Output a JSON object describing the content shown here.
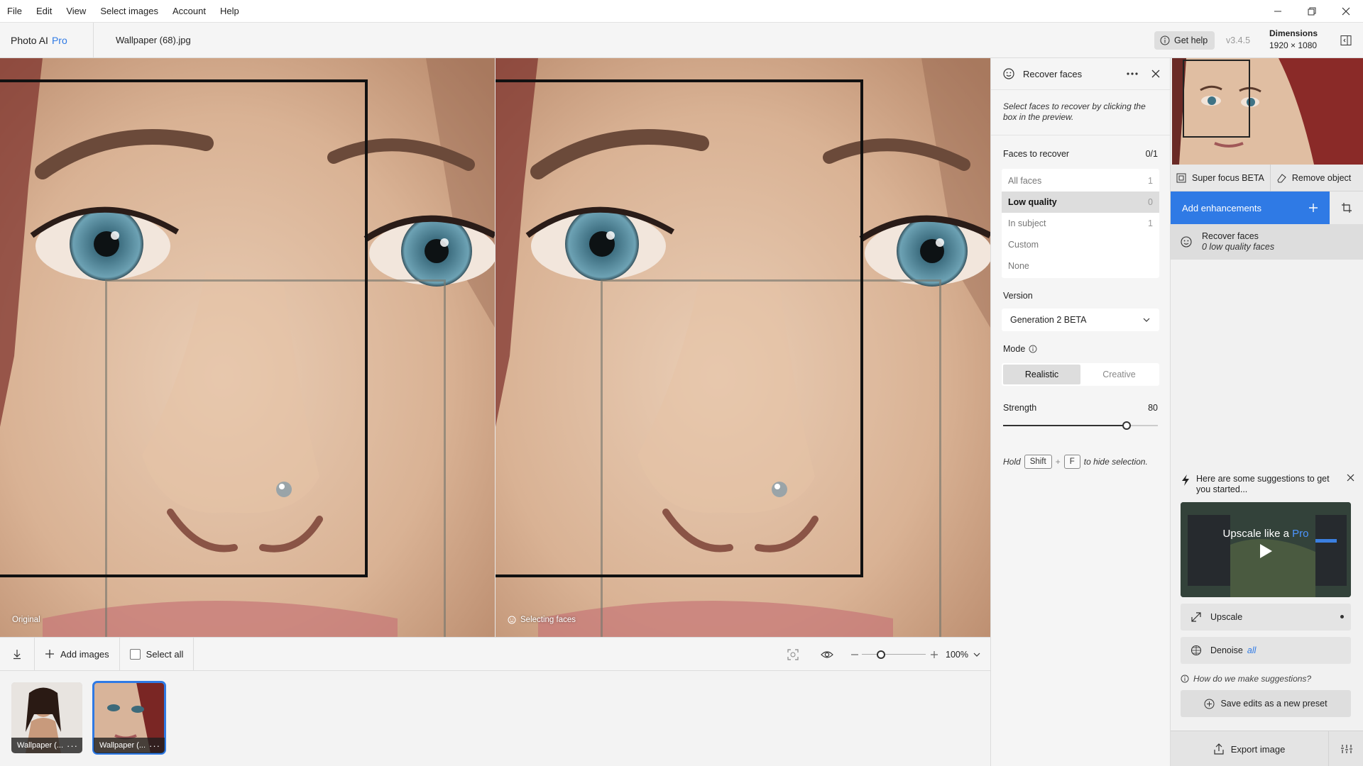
{
  "menu": [
    "File",
    "Edit",
    "View",
    "Select images",
    "Account",
    "Help"
  ],
  "header": {
    "brand": "Photo AI",
    "brand_tier": "Pro",
    "filename": "Wallpaper (68).jpg",
    "get_help": "Get help",
    "version": "v3.4.5",
    "dimensions_title": "Dimensions",
    "dimensions_value": "1920 × 1080"
  },
  "preview": {
    "left_label": "Original",
    "right_label": "Selecting faces"
  },
  "bottombar": {
    "add_images": "Add images",
    "select_all": "Select all",
    "zoom": "100%",
    "zoom_level": 0.3
  },
  "filmstrip": [
    {
      "caption": "Wallpaper (..."
    },
    {
      "caption": "Wallpaper (..."
    }
  ],
  "tool_panel": {
    "title": "Recover faces",
    "hint": "Select faces to recover by clicking the box in the preview.",
    "faces_label": "Faces to recover",
    "faces_count": "0/1",
    "face_options": [
      {
        "label": "All faces",
        "count": "1"
      },
      {
        "label": "Low quality",
        "count": "0"
      },
      {
        "label": "In subject",
        "count": "1"
      },
      {
        "label": "Custom",
        "count": ""
      },
      {
        "label": "None",
        "count": ""
      }
    ],
    "version_label": "Version",
    "version_value": "Generation 2 BETA",
    "mode_label": "Mode",
    "mode_options": [
      "Realistic",
      "Creative"
    ],
    "strength_label": "Strength",
    "strength_value": "80",
    "strength": 80,
    "hold_prefix": "Hold",
    "key_shift": "Shift",
    "key_plus": "+",
    "key_f": "F",
    "hold_suffix": "to hide selection."
  },
  "right_panel": {
    "tab_super_focus": "Super focus BETA",
    "tab_remove_object": "Remove object",
    "add_enhancements": "Add enhancements",
    "enhancement_title": "Recover faces",
    "enhancement_sub": "0 low quality faces",
    "suggest_title": "Here are some suggestions to get you started...",
    "video_title_a": "Upscale like a",
    "video_title_b": "Pro",
    "sug_upscale": "Upscale",
    "sug_denoise": "Denoise",
    "sug_denoise_tag": "all",
    "how_suggest": "How do we make suggestions?",
    "save_preset": "Save edits as a new preset",
    "export": "Export image"
  },
  "colors": {
    "accent": "#2f7ae5"
  }
}
